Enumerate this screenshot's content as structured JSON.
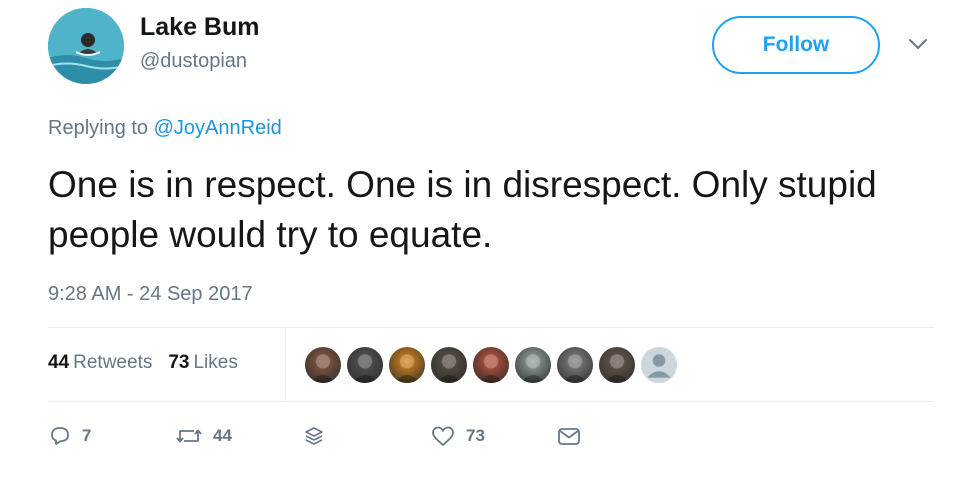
{
  "author": {
    "display_name": "Lake Bum",
    "handle": "@dustopian",
    "avatar_icon": "swimmer-avatar"
  },
  "follow_label": "Follow",
  "reply_context": {
    "prefix": "Replying to ",
    "mention": "@JoyAnnReid"
  },
  "tweet_text": "One is in respect. One is in disrespect. Only stupid people would try to equate.",
  "timestamp": "9:28 AM - 24 Sep 2017",
  "stats": {
    "retweets_count": "44",
    "retweets_label": "Retweets",
    "likes_count": "73",
    "likes_label": "Likes"
  },
  "likers": [
    {
      "name": "liker-1",
      "color": "#8a5a44"
    },
    {
      "name": "liker-2",
      "color": "#555555"
    },
    {
      "name": "liker-3",
      "color": "#e08a1a"
    },
    {
      "name": "liker-4",
      "color": "#5c5147"
    },
    {
      "name": "liker-5",
      "color": "#c0533a"
    },
    {
      "name": "liker-6",
      "color": "#9aa8a0"
    },
    {
      "name": "liker-7",
      "color": "#7d8583"
    },
    {
      "name": "liker-8",
      "color": "#6b5b4d"
    },
    {
      "name": "liker-9-default",
      "color": "#ccd6dd"
    }
  ],
  "actions": {
    "reply_count": "7",
    "retweet_count": "44",
    "like_count": "73"
  },
  "colors": {
    "accent": "#1da1f2",
    "text": "#14171a",
    "secondary": "#657786"
  }
}
